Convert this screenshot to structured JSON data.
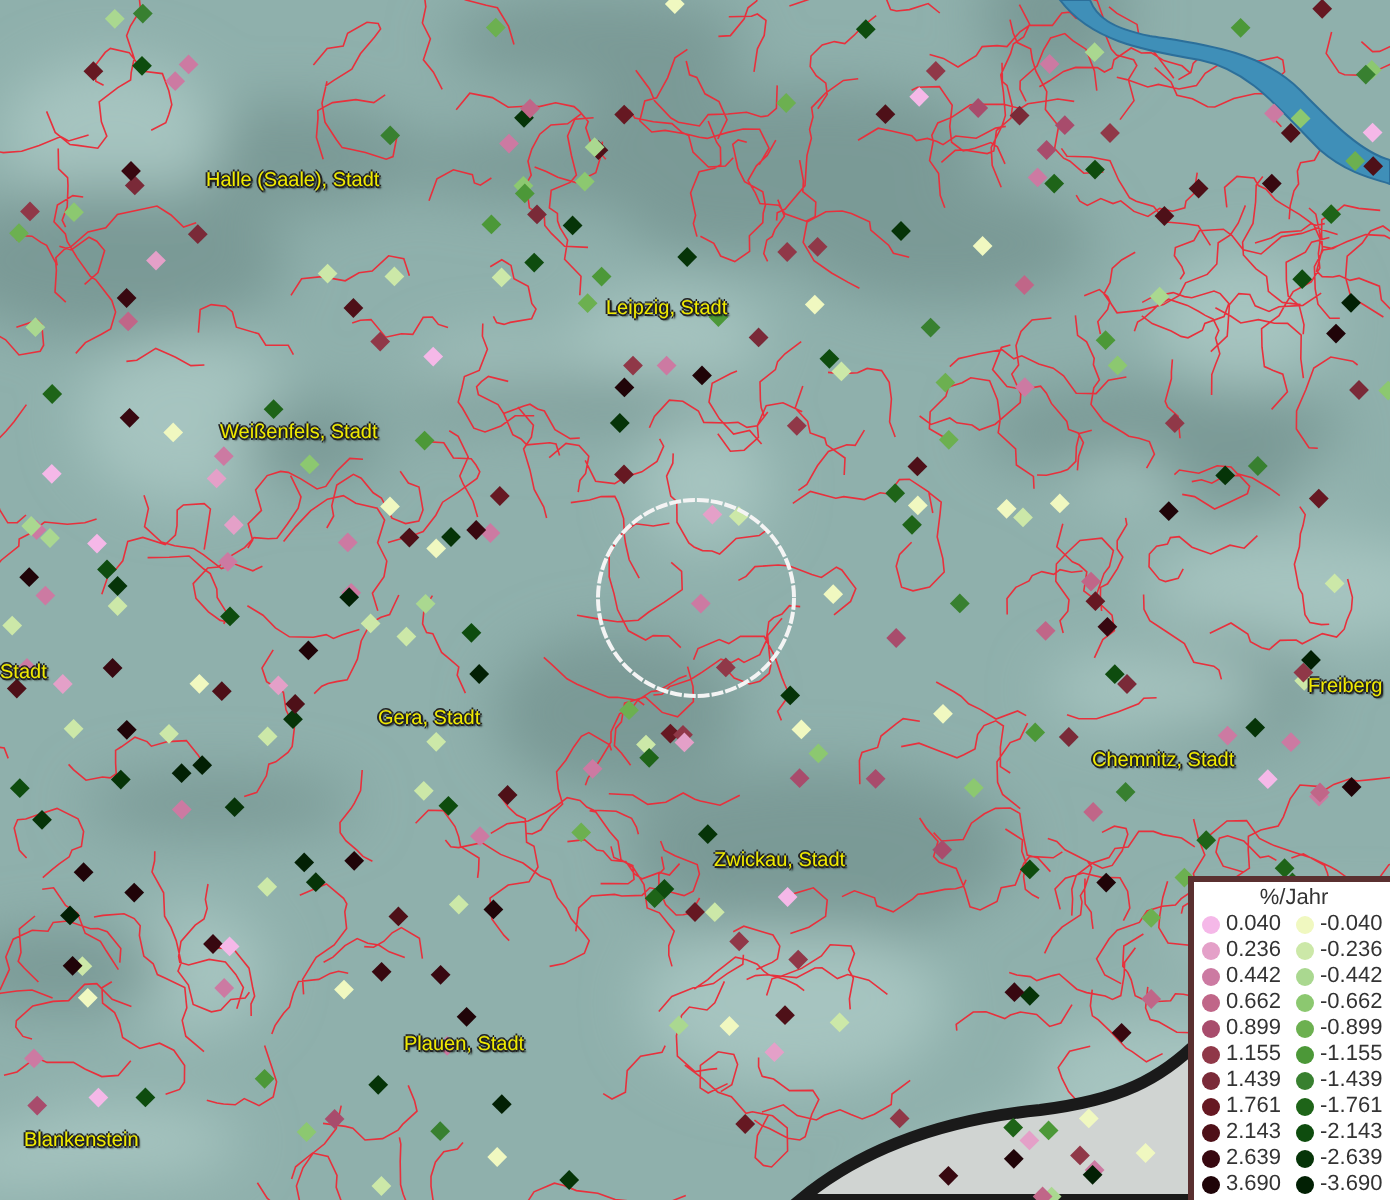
{
  "map": {
    "labels": [
      {
        "text": "Halle (Saale), Stadt"
      },
      {
        "text": "Leipzig, Stadt"
      },
      {
        "text": "Weißenfels, Stadt"
      },
      {
        "text": "Stadt"
      },
      {
        "text": "Gera, Stadt"
      },
      {
        "text": "Freiberg"
      },
      {
        "text": "Chemnitz, Stadt"
      },
      {
        "text": "Zwickau, Stadt"
      },
      {
        "text": "Plauen, Stadt"
      },
      {
        "text": "Blankenstein"
      }
    ]
  },
  "legend": {
    "title": "%/Jahr",
    "items": [
      {
        "label": "0.040",
        "color": "#f5b8e8"
      },
      {
        "label": "-0.040",
        "color": "#f0f8c0"
      },
      {
        "label": "0.236",
        "color": "#e4a0c8"
      },
      {
        "label": "-0.236",
        "color": "#cce8a8"
      },
      {
        "label": "0.442",
        "color": "#cc7aa2"
      },
      {
        "label": "-0.442",
        "color": "#aad890"
      },
      {
        "label": "0.662",
        "color": "#c06688"
      },
      {
        "label": "-0.662",
        "color": "#8cc870"
      },
      {
        "label": "0.899",
        "color": "#a84c6c"
      },
      {
        "label": "-0.899",
        "color": "#6cb050"
      },
      {
        "label": "1.155",
        "color": "#903848"
      },
      {
        "label": "-1.155",
        "color": "#4c9838"
      },
      {
        "label": "1.439",
        "color": "#7a2a38"
      },
      {
        "label": "-1.439",
        "color": "#388030"
      },
      {
        "label": "1.761",
        "color": "#661822"
      },
      {
        "label": "-1.761",
        "color": "#1e6418"
      },
      {
        "label": "2.143",
        "color": "#4e1018"
      },
      {
        "label": "-2.143",
        "color": "#0e4c0e"
      },
      {
        "label": "2.639",
        "color": "#380810"
      },
      {
        "label": "-2.639",
        "color": "#063408"
      },
      {
        "label": "3.690",
        "color": "#200408"
      },
      {
        "label": "-3.690",
        "color": "#022004"
      }
    ]
  }
}
